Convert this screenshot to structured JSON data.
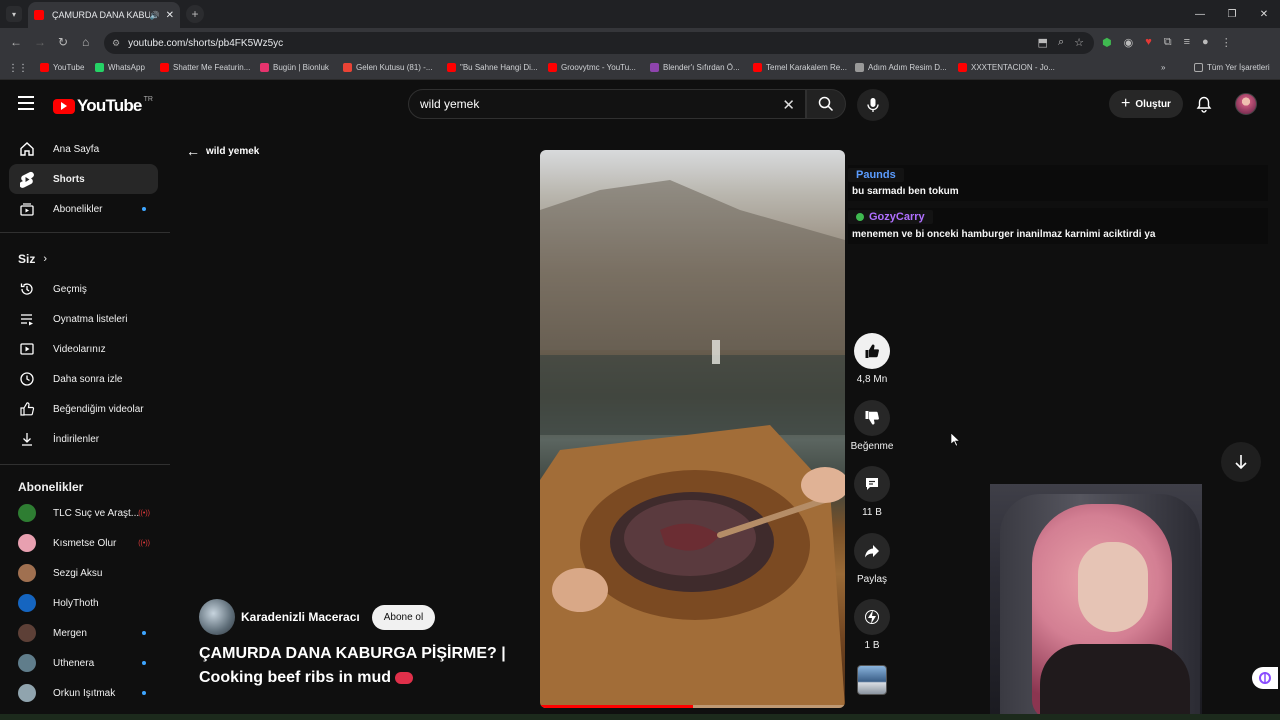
{
  "browser": {
    "tab_title": "ÇAMURDA DANA KABURGA",
    "url": "youtube.com/shorts/pb4FK5Wz5yc",
    "bookmarks": [
      {
        "label": "YouTube",
        "color": "#ff0000"
      },
      {
        "label": "WhatsApp",
        "color": "#25d366"
      },
      {
        "label": "Shatter Me Featurin...",
        "color": "#ff0000"
      },
      {
        "label": "Bugün | Bionluk",
        "color": "#e6336d"
      },
      {
        "label": "Gelen Kutusu (81) -...",
        "color": "#ea4335"
      },
      {
        "label": "\"Bu Sahne Hangi Di...",
        "color": "#ff0000"
      },
      {
        "label": "Groovytmc - YouTu...",
        "color": "#ff0000"
      },
      {
        "label": "Blender'ı Sıfırdan Ö...",
        "color": "#8e44ad"
      },
      {
        "label": "Temel Karakalem Re...",
        "color": "#ff0000"
      },
      {
        "label": "Adım Adım Resim D...",
        "color": "#999999"
      },
      {
        "label": "XXXTENTACION - Jo...",
        "color": "#ff0000"
      }
    ],
    "all_bookmarks_label": "Tüm Yer İşaretleri"
  },
  "masthead": {
    "logo_text": "YouTube",
    "country_code": "TR",
    "search_value": "wild yemek",
    "create_label": "Oluştur"
  },
  "sidebar": {
    "main": [
      {
        "label": "Ana Sayfa",
        "icon": "home-icon"
      },
      {
        "label": "Shorts",
        "icon": "shorts-icon"
      },
      {
        "label": "Abonelikler",
        "icon": "subscriptions-icon"
      }
    ],
    "you_heading": "Siz",
    "you": [
      {
        "label": "Geçmiş",
        "icon": "history-icon"
      },
      {
        "label": "Oynatma listeleri",
        "icon": "playlist-icon"
      },
      {
        "label": "Videolarınız",
        "icon": "your-videos-icon"
      },
      {
        "label": "Daha sonra izle",
        "icon": "watch-later-icon"
      },
      {
        "label": "Beğendiğim videolar",
        "icon": "liked-icon"
      },
      {
        "label": "İndirilenler",
        "icon": "download-icon"
      }
    ],
    "subs_heading": "Abonelikler",
    "subs": [
      {
        "label": "TLC Suç ve Araşt...",
        "color": "#2e7d32"
      },
      {
        "label": "Kısmetse Olur",
        "color": "#e8a0b0"
      },
      {
        "label": "Sezgi Aksu",
        "color": "#a07050"
      },
      {
        "label": "HolyThoth",
        "color": "#1565c0"
      },
      {
        "label": "Mergen",
        "color": "#5d4037"
      },
      {
        "label": "Uthenera",
        "color": "#607d8b"
      },
      {
        "label": "Orkun Işıtmak",
        "color": "#90a4ae"
      }
    ]
  },
  "shorts": {
    "back_label": "wild yemek",
    "channel": "Karadenizli Maceracı",
    "subscribe_label": "Abone ol",
    "title": "ÇAMURDA DANA KABURGA PİŞİRME? | Cooking beef ribs in mud",
    "progress": 0.5,
    "like_count": "4,8 Mn",
    "dislike_label": "Beğenme",
    "comment_count": "11 B",
    "share_label": "Paylaş",
    "remix_count": "1 B"
  },
  "chat": [
    {
      "user": "Paunds",
      "color": "#5b9cff",
      "text": "bu sarmadı ben tokum"
    },
    {
      "user": "GozyCarry",
      "color": "#b070ff",
      "text": "menemen ve bi onceki hamburger inanilmaz karnimi aciktirdi ya"
    }
  ]
}
